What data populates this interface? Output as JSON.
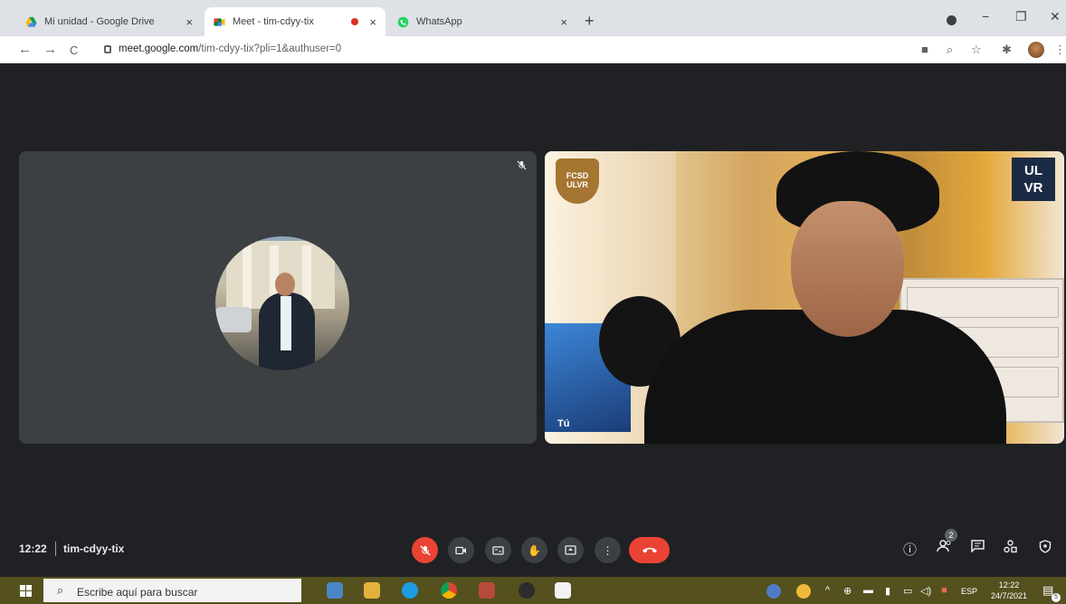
{
  "browser": {
    "tabs": [
      {
        "title": "Mi unidad - Google Drive",
        "close": "×"
      },
      {
        "title": "Meet - tim-cdyy-tix",
        "close": "×"
      },
      {
        "title": "WhatsApp",
        "close": "×"
      }
    ],
    "new_tab": "+",
    "window_controls": {
      "minimize": "−",
      "restore": "❐",
      "close": "✕"
    },
    "nav": {
      "back": "←",
      "forward": "→",
      "reload": "C"
    },
    "url_host": "meet.google.com",
    "url_path": "/tim-cdyy-tix?pli=1&authuser=0"
  },
  "meet": {
    "clock": "12:22",
    "meeting_code": "tim-cdyy-tix",
    "self_label": "Tú",
    "self_badge": "FCSD\nULVR",
    "self_logo": "UL\nVR",
    "participants_count": "2"
  },
  "taskbar": {
    "search_placeholder": "Escribe aquí para buscar",
    "lang": "ESP",
    "time": "12:22",
    "date": "24/7/2021",
    "notifications": "5"
  }
}
